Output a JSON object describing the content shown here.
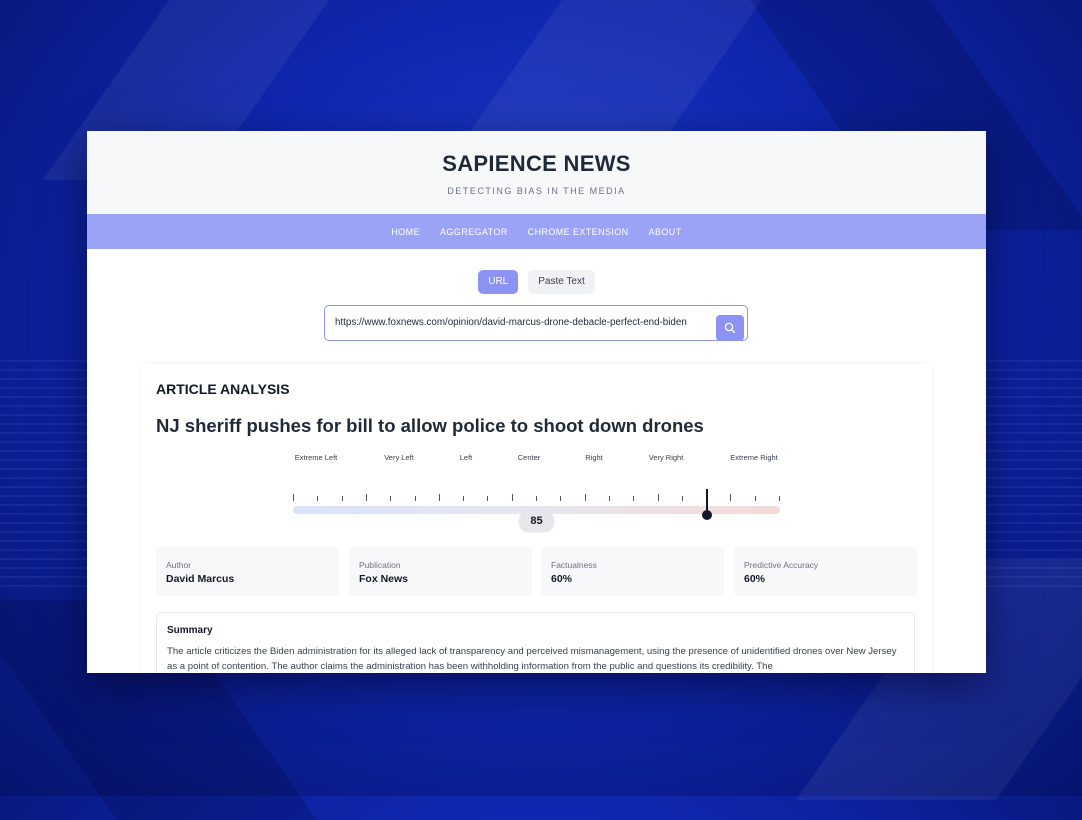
{
  "header": {
    "brand": "SAPIENCE NEWS",
    "tagline": "DETECTING BIAS IN THE MEDIA"
  },
  "nav": {
    "items": [
      "HOME",
      "AGGREGATOR",
      "CHROME EXTENSION",
      "ABOUT"
    ]
  },
  "input_mode": {
    "options": [
      "URL",
      "Paste Text"
    ],
    "selected": "URL"
  },
  "search": {
    "value": "https://www.foxnews.com/opinion/david-marcus-drone-debacle-perfect-end-biden",
    "icon": "search-icon"
  },
  "analysis": {
    "section_title": "ARTICLE ANALYSIS",
    "article_title": "NJ sheriff pushes for bill to allow police to shoot down drones",
    "bias_scale": {
      "labels": [
        "Extreme Left",
        "Very Left",
        "Left",
        "Center",
        "Right",
        "Very Right",
        "Extreme Right"
      ],
      "score": "85",
      "score_fraction": 0.85
    },
    "info": [
      {
        "label": "Author",
        "value": "David Marcus"
      },
      {
        "label": "Publication",
        "value": "Fox News"
      },
      {
        "label": "Factualness",
        "value": "60%"
      },
      {
        "label": "Predictive Accuracy",
        "value": "60%"
      }
    ],
    "summary": {
      "title": "Summary",
      "text": "The article criticizes the Biden administration for its alleged lack of transparency and perceived mismanagement, using the presence of unidentified drones over New Jersey as a point of contention. The author claims the administration has been withholding information from the public and questions its credibility. The"
    }
  },
  "colors": {
    "accent": "#8c93f3",
    "nav_bar": "#9aa3f6",
    "background": "#1f3fd0"
  }
}
